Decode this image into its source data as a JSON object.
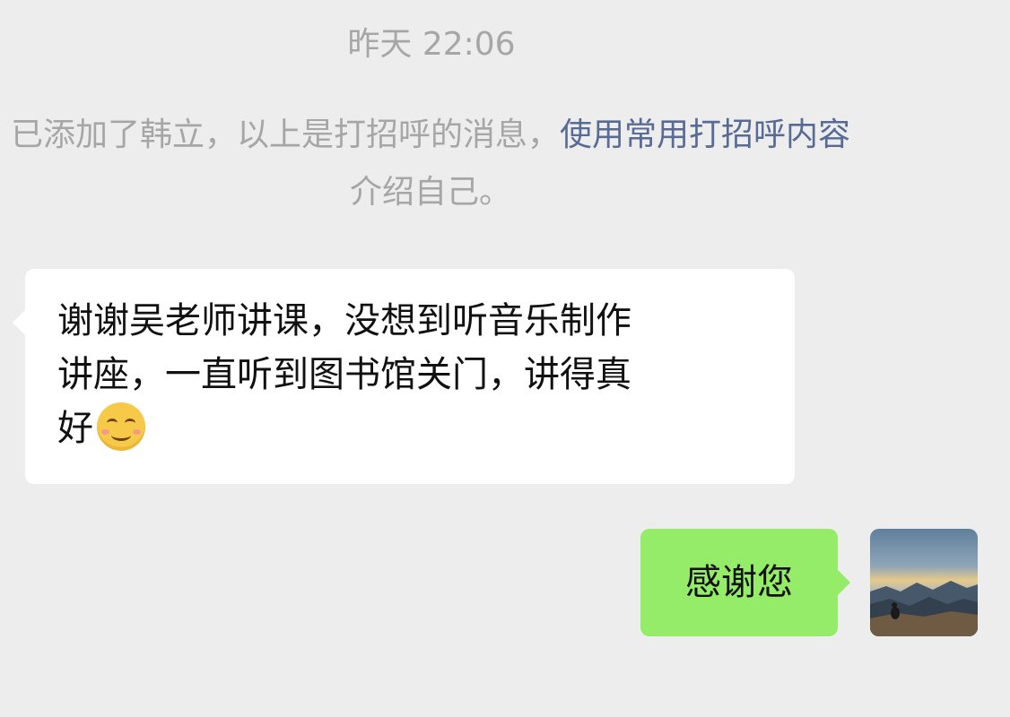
{
  "chat": {
    "timestamp": "昨天 22:06",
    "system_notice": {
      "prefix": "已添加了韩立，以上是打招呼的消息，",
      "link": "使用常用打招呼内容",
      "suffix": "介绍自己。"
    },
    "messages": [
      {
        "direction": "incoming",
        "lines": [
          "谢谢吴老师讲课，没想到听音乐制作",
          "讲座，一直听到图书馆关门，讲得真",
          "好"
        ],
        "emoji": "smiling-face-with-smiling-eyes"
      },
      {
        "direction": "outgoing",
        "text": "感谢您"
      }
    ]
  },
  "colors": {
    "background": "#ededed",
    "incoming_bubble": "#ffffff",
    "outgoing_bubble": "#95ec69",
    "system_text": "#a6a6a6",
    "link_text": "#576b95"
  }
}
